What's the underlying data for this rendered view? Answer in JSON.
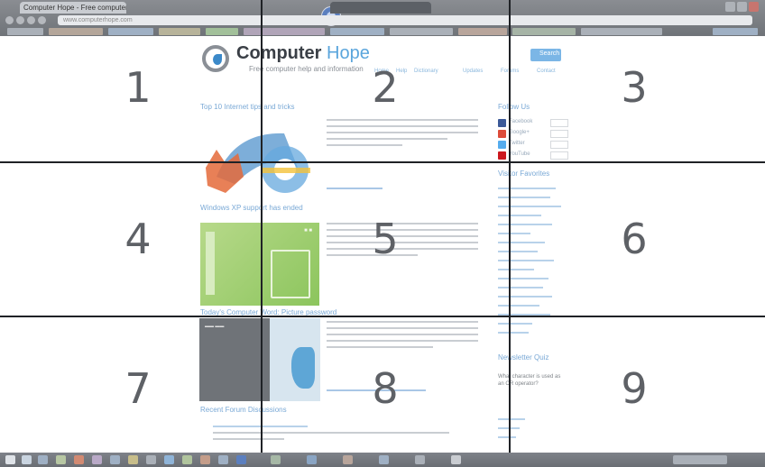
{
  "browser": {
    "tab_title": "Computer Hope - Free computer help",
    "popup_tab_title": "",
    "address": "www.computerhope.com",
    "colors": {
      "chrome": "#74787d",
      "accent": "#5aa5dc"
    }
  },
  "site": {
    "logo_main": "Computer",
    "logo_accent": "Hope",
    "tagline": "Free computer help and information",
    "search_button": "Search",
    "nav": [
      "Home",
      "Help",
      "Dictionary",
      "Updates",
      "Forums",
      "Contact"
    ]
  },
  "articles": [
    {
      "title": "Top 10 Internet tips and tricks",
      "thumb_icon": "browser-logos-icon"
    },
    {
      "title": "Windows XP support has ended",
      "thumb_icon": "windows-xp-icon"
    },
    {
      "title": "Today's Computer Word: Picture password",
      "thumb_icon": "picture-password-icon"
    },
    {
      "title": "Recent Forum Discussions"
    }
  ],
  "sidebar": {
    "follow_heading": "Follow Us",
    "social": [
      {
        "name": "Facebook",
        "icon": "facebook-icon",
        "color": "#3b5998"
      },
      {
        "name": "Google+",
        "icon": "google-plus-icon",
        "color": "#dd4b39"
      },
      {
        "name": "Twitter",
        "icon": "twitter-icon",
        "color": "#55acee"
      },
      {
        "name": "YouTube",
        "icon": "youtube-icon",
        "color": "#cc181e"
      }
    ],
    "favorites_heading": "Visitor Favorites",
    "newsletter_heading": "Newsletter Quiz",
    "quiz_question": "What character is used as an OR operator?"
  },
  "grid_numbers": [
    "1",
    "2",
    "3",
    "4",
    "5",
    "6",
    "7",
    "8",
    "9"
  ]
}
